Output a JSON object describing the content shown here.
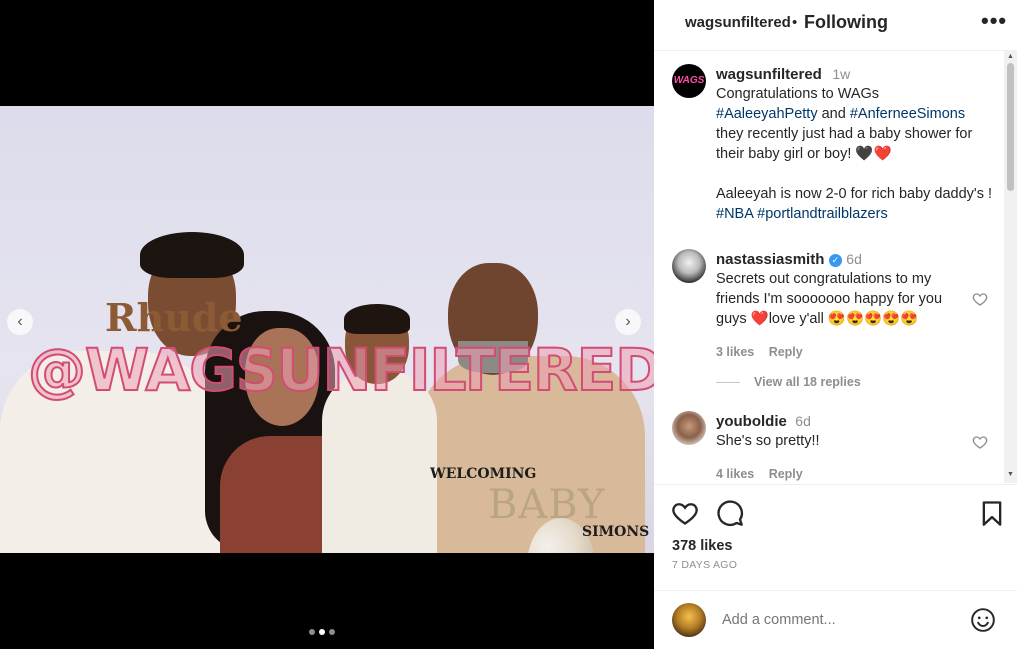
{
  "image": {
    "watermark": "@WAGSUNFILTERED",
    "shirt_text": "Rhude",
    "banner_line1": "WELCOMING",
    "banner_line2": "BABY",
    "banner_line3": "SIMONS",
    "carousel_pages": 3,
    "carousel_active_index": 1
  },
  "header": {
    "username": "wagsunfiltered",
    "separator": "•",
    "follow_state": "Following",
    "more_icon": "more-horizontal-icon"
  },
  "caption": {
    "avatar_text": "WAGS",
    "username": "wagsunfiltered",
    "time": "1w",
    "text_1": "Congratulations to WAGs",
    "tag_1": "#AaleeyahPetty",
    "and": "and",
    "tag_2": "#AnferneeSimons",
    "text_2": "they recently just had a baby shower for their baby girl or boy! 🖤❤️",
    "text_3": "Aaleeyah is now 2-0 for rich baby daddy's !",
    "tag_3": "#NBA",
    "tag_4": "#portlandtrailblazers"
  },
  "comments": [
    {
      "username": "nastassiasmith",
      "time": "6d",
      "text": "Secrets out congratulations to my friends I'm sooooooo happy for you guys ❤️love y'all 😍😍😍😍😍",
      "likes": "3 likes",
      "reply": "Reply",
      "view_replies": "View all 18 replies"
    },
    {
      "username": "youboldie",
      "time": "6d",
      "text": "She's so pretty!!",
      "likes": "4 likes",
      "reply": "Reply"
    }
  ],
  "footer": {
    "likes": "378 likes",
    "posted": "7 DAYS AGO",
    "comment_placeholder": "Add a comment..."
  },
  "colors": {
    "link": "#00376b",
    "verified": "#3897f0",
    "heart_red": "#ed4956",
    "watermark_pink": "#d34c73"
  }
}
